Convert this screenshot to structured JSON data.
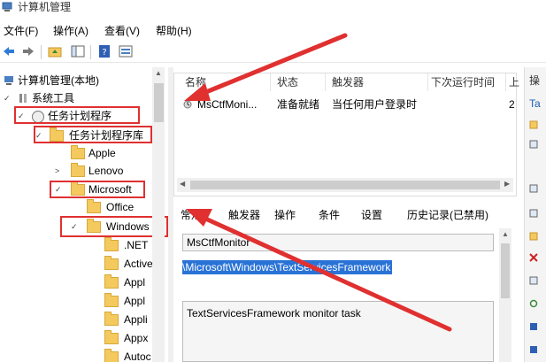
{
  "window": {
    "title": "计算机管理"
  },
  "menu": [
    "文件(F)",
    "操作(A)",
    "查看(V)",
    "帮助(H)"
  ],
  "toolbar": {
    "buttons": [
      "back-icon",
      "forward-icon",
      "up-folder-icon",
      "show-hide-tree-icon",
      "help-icon",
      "properties-icon"
    ]
  },
  "tree": {
    "root": "计算机管理(本地)",
    "system_tools": "系统工具",
    "task_scheduler": "任务计划程序",
    "task_library": "任务计划程序库",
    "apple": "Apple",
    "lenovo": "Lenovo",
    "microsoft": "Microsoft",
    "office": "Office",
    "windows": "Windows",
    "children": [
      ".NET",
      "Active",
      "Appl",
      "Appl",
      "Appli",
      "Appx",
      "Autoc"
    ]
  },
  "list": {
    "columns": [
      "名称",
      "状态",
      "触发器",
      "下次运行时间",
      "上"
    ],
    "rows": [
      {
        "name": "MsCtfMoni...",
        "status": "准备就绪",
        "trigger": "当任何用户登录时",
        "next": "2"
      }
    ]
  },
  "tabs": [
    "常规",
    "触发器",
    "操作",
    "条件",
    "设置",
    "历史记录(已禁用)"
  ],
  "detail": {
    "name": "MsCtfMonitor",
    "path": "\\Microsoft\\Windows\\TextServicesFramework",
    "description": "TextServicesFramework monitor task"
  },
  "right_panel": {
    "header": "操",
    "item": "Ta"
  },
  "annotation_color": "#e03030"
}
